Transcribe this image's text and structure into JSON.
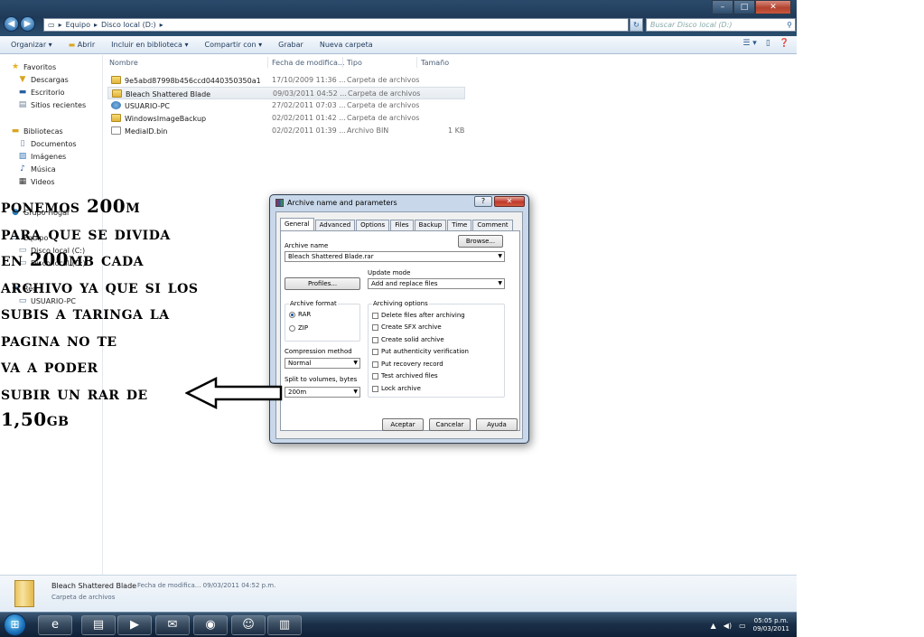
{
  "window": {
    "controls": [
      "–",
      "□",
      "✕"
    ],
    "breadcrumb": [
      "Equipo",
      "Disco local (D:)"
    ],
    "search_placeholder": "Buscar Disco local (D:)"
  },
  "toolbar": {
    "organizar": "Organizar ▾",
    "abrir": "Abrir",
    "incluir": "Incluir en biblioteca ▾",
    "compartir": "Compartir con ▾",
    "grabar": "Grabar",
    "nueva_carpeta": "Nueva carpeta"
  },
  "navpane": {
    "favoritos": "Favoritos",
    "descargas": "Descargas",
    "escritorio": "Escritorio",
    "sitios": "Sitios recientes",
    "bibliotecas": "Bibliotecas",
    "documentos": "Documentos",
    "imagenes": "Imágenes",
    "musica": "Música",
    "videos": "Videos",
    "grupo_hogar": "Grupo Hogar",
    "equipo": "Equipo",
    "disco_c": "Disco local (C:)",
    "disco_d": "Disco local (D:)",
    "red": "Red",
    "usuario_pc": "USUARIO-PC"
  },
  "filelist": {
    "headers": {
      "nombre": "Nombre",
      "fecha": "Fecha de modifica...",
      "tipo": "Tipo",
      "tamano": "Tamaño"
    },
    "rows": [
      {
        "name": "9e5abd87998b456ccd0440350350a1",
        "date": "17/10/2009 11:36 ...",
        "type": "Carpeta de archivos",
        "size": ""
      },
      {
        "name": "Bleach Shattered Blade",
        "date": "09/03/2011 04:52 ...",
        "type": "Carpeta de archivos",
        "size": ""
      },
      {
        "name": "USUARIO-PC",
        "date": "27/02/2011 07:03 ...",
        "type": "Carpeta de archivos",
        "size": ""
      },
      {
        "name": "WindowsImageBackup",
        "date": "02/02/2011 01:42 ...",
        "type": "Carpeta de archivos",
        "size": ""
      },
      {
        "name": "MediaID.bin",
        "date": "02/02/2011 01:39 ...",
        "type": "Archivo BIN",
        "size": "1 KB"
      }
    ]
  },
  "details": {
    "name": "Bleach Shattered Blade",
    "meta": "Fecha de modifica... 09/03/2011 04:52 p.m.",
    "type": "Carpeta de archivos"
  },
  "taskbar": {
    "clock_time": "05:05 p.m.",
    "clock_date": "09/03/2011"
  },
  "dialog": {
    "title": "Archive name and parameters",
    "help": "?",
    "close": "✕",
    "tabs": [
      "General",
      "Advanced",
      "Options",
      "Files",
      "Backup",
      "Time",
      "Comment"
    ],
    "archive_name_label": "Archive name",
    "browse": "Browse...",
    "archive_name_value": "Bleach Shattered Blade.rar",
    "update_mode_label": "Update mode",
    "update_mode_value": "Add and replace files",
    "profiles": "Profiles...",
    "archive_format_label": "Archive format",
    "rar": "RAR",
    "zip": "ZIP",
    "compression_label": "Compression method",
    "compression_value": "Normal",
    "split_label": "Split to volumes, bytes",
    "split_value": "200m",
    "archiving_options_label": "Archiving options",
    "options": [
      "Delete files after archiving",
      "Create SFX archive",
      "Create solid archive",
      "Put authenticity verification",
      "Put recovery record",
      "Test archived files",
      "Lock archive"
    ],
    "aceptar": "Aceptar",
    "cancelar": "Cancelar",
    "ayuda": "Ayuda"
  },
  "annotation": {
    "lines": [
      "ponemos 200m",
      "para que se divida",
      "en 200mb cada",
      "archivo ya que si los",
      "subis a taringa la",
      "pagina no te",
      "va a poder",
      "subir un rar de",
      "1,50gb"
    ]
  }
}
